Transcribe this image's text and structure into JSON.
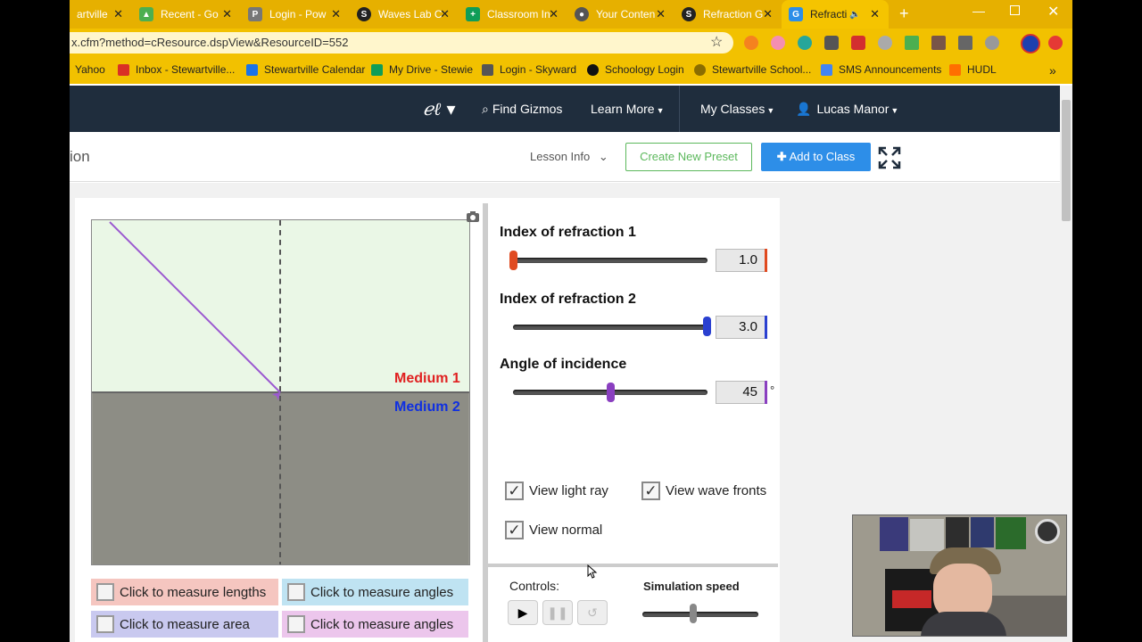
{
  "browser": {
    "tabs": [
      {
        "title": "artville",
        "icon_color": "#e6b000"
      },
      {
        "title": "Recent - Go",
        "icon_color": "#4caf50"
      },
      {
        "title": "Login - Pow",
        "icon_color": "#777"
      },
      {
        "title": "Waves Lab C",
        "icon_color": "#222"
      },
      {
        "title": "Classroom In",
        "icon_color": "#0f9d58"
      },
      {
        "title": "Your Conten",
        "icon_color": "#555"
      },
      {
        "title": "Refraction G",
        "icon_color": "#222"
      },
      {
        "title": "Refracti",
        "icon_color": "#2d8ee8"
      }
    ],
    "new_tab": "+",
    "url": "x.cfm?method=cResource.dspView&ResourceID=552",
    "bookmarks": [
      {
        "label": "Yahoo",
        "color": "#6001d2"
      },
      {
        "label": "Inbox - Stewartville...",
        "color": "#d93025"
      },
      {
        "label": "Stewartville Calendar",
        "color": "#1a73e8"
      },
      {
        "label": "My Drive - Stewie",
        "color": "#0f9d58"
      },
      {
        "label": "Login - Skyward",
        "color": "#555"
      },
      {
        "label": "Schoology Login",
        "color": "#111"
      },
      {
        "label": "Stewartville School...",
        "color": "#8a6d00"
      },
      {
        "label": "SMS Announcements",
        "color": "#4285f4"
      },
      {
        "label": "HUDL",
        "color": "#ff6f00"
      }
    ],
    "more_bookmarks": "»"
  },
  "navbar": {
    "find_gizmos": "Find Gizmos",
    "learn_more": "Learn More",
    "my_classes": "My Classes",
    "user": "Lucas Manor"
  },
  "subheader": {
    "title": "ion",
    "lesson_info": "Lesson Info",
    "create_preset": "Create New Preset",
    "add_to_class": "Add to Class"
  },
  "simulation": {
    "medium1": "Medium 1",
    "medium2": "Medium 2",
    "medium1_color": "#e02020",
    "medium2_color": "#1030e0",
    "incident_angle_deg": 45
  },
  "controls": {
    "n1_label": "Index of refraction 1",
    "n1_value": "1.0",
    "n2_label": "Index of refraction 2",
    "n2_value": "3.0",
    "angle_label": "Angle of incidence",
    "angle_value": "45",
    "degree_symbol": "°",
    "view_light_ray": "View light ray",
    "view_wave_fronts": "View wave fronts",
    "view_normal": "View normal",
    "controls_label": "Controls:",
    "sim_speed_label": "Simulation speed"
  },
  "measure": {
    "lengths": "Click to measure lengths",
    "angles1": "Click to measure angles",
    "area": "Click to measure area",
    "angles2": "Click to measure angles"
  }
}
